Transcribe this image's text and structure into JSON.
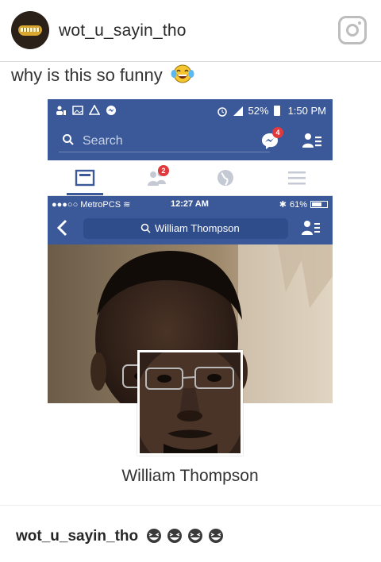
{
  "post": {
    "username": "wot_u_sayin_tho",
    "avatar_icon": "gold-grill-avatar",
    "camera_icon": "instagram-camera-icon",
    "caption": "why is this so funny",
    "caption_emoji": "face-with-tears-of-joy"
  },
  "screenshot": {
    "android_status": {
      "battery": "52%",
      "time": "1:50 PM",
      "icons": [
        "facebook-friends-icon",
        "image-icon",
        "drive-icon",
        "messenger-icon",
        "alarm-icon",
        "signal-icon",
        "battery-icon"
      ]
    },
    "facebook_bar": {
      "search_placeholder": "Search",
      "messenger_badge": "4",
      "friend_requests_icon": "friend-requests-icon"
    },
    "tabs": {
      "friends_badge": "2",
      "items": [
        "news-feed-tab",
        "friends-tab",
        "notifications-globe-tab",
        "menu-tab"
      ]
    },
    "ios_status": {
      "carrier": "MetroPCS",
      "signal_dots": "●●●○○",
      "time": "12:27 AM",
      "battery": "61%"
    },
    "ios_nav": {
      "search_query": "William Thompson"
    },
    "profile": {
      "name": "William Thompson"
    }
  },
  "comment": {
    "username": "wot_u_sayin_tho",
    "emoji_count": 4,
    "emoji": "grinning-squinting-face"
  },
  "colors": {
    "facebook_blue": "#3b5998",
    "badge_red": "#e0393e"
  }
}
